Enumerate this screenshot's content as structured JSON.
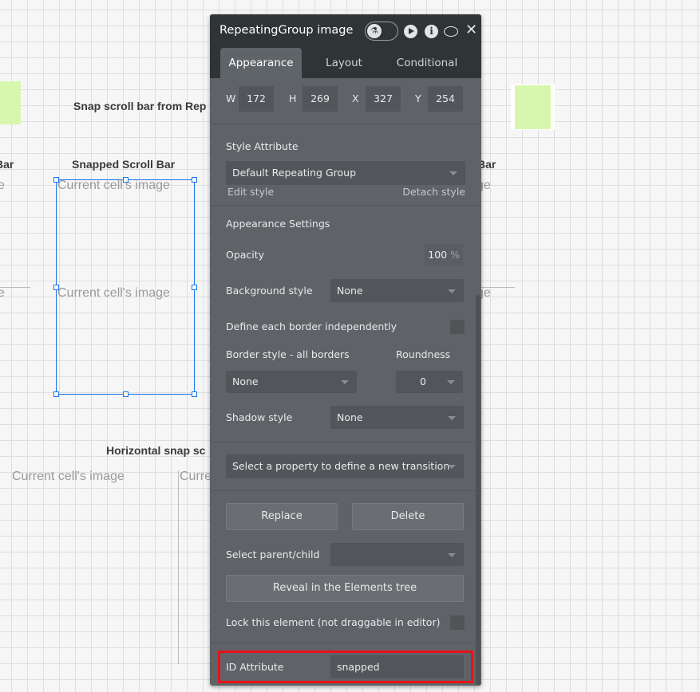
{
  "canvas": {
    "heading_snap_from_rep": "Snap scroll bar from Rep",
    "heading_bar_left": "Bar",
    "heading_snapped": "Snapped Scroll Bar",
    "heading_bar_right": "Bar",
    "heading_horizontal": "Horizontal snap sc",
    "cell_image": "Current cell's image",
    "cell_fragment_e": "e",
    "cell_fragment_ge": "ge",
    "cell_fragment_curre": "Curre",
    "selection_color": "#1a73e8"
  },
  "panel": {
    "title": "RepeatingGroup image",
    "header_icons": [
      "flask-toggle-icon",
      "play-icon",
      "info-icon",
      "comment-icon",
      "close-icon"
    ],
    "tabs": [
      {
        "label": "Appearance",
        "active": true
      },
      {
        "label": "Layout"
      },
      {
        "label": "Conditional"
      }
    ],
    "geometry": {
      "w_label": "W",
      "w": "172",
      "h_label": "H",
      "h": "269",
      "x_label": "X",
      "x": "327",
      "y_label": "Y",
      "y": "254"
    },
    "style_attribute_label": "Style Attribute",
    "style_value": "Default Repeating Group",
    "edit_style": "Edit style",
    "detach_style": "Detach style",
    "appearance_settings": "Appearance Settings",
    "opacity_label": "Opacity",
    "opacity_value": "100",
    "opacity_unit": "%",
    "background_style_label": "Background style",
    "background_style_value": "None",
    "define_borders_label": "Define each border independently",
    "border_style_label": "Border style - all borders",
    "roundness_label": "Roundness",
    "border_style_value": "None",
    "roundness_value": "0",
    "shadow_style_label": "Shadow style",
    "shadow_style_value": "None",
    "transition_placeholder": "Select a property to define a new transition",
    "replace_label": "Replace",
    "delete_label": "Delete",
    "select_parent_label": "Select parent/child",
    "select_parent_value": "",
    "reveal_label": "Reveal in the Elements tree",
    "lock_label": "Lock this element (not draggable in editor)",
    "id_attribute_label": "ID Attribute",
    "id_attribute_value": "snapped",
    "highlight_color": "#e8121a"
  }
}
